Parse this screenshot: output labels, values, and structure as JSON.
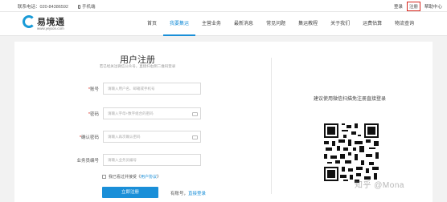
{
  "topbar": {
    "contact_label": "联系电话：",
    "contact_phone": "020-84386592",
    "mobile_label": "手机端",
    "login": "登录",
    "register": "注册",
    "help": "帮助中心"
  },
  "logo": {
    "name": "易境通",
    "url": "www.yejoon.com"
  },
  "nav": [
    "首页",
    "我要集运",
    "主营业务",
    "最新消息",
    "常见问题",
    "集运教程",
    "关于我们",
    "运费估算",
    "物流查询"
  ],
  "form": {
    "title": "用户注册",
    "subtitle": "若已经关注微信公众号，直接扫右侧二维码登录",
    "fields": [
      {
        "label": "账号",
        "required": true,
        "placeholder": "请输入用户名、邮箱或手机号"
      },
      {
        "label": "密码",
        "required": true,
        "placeholder": "请输入字母+数字组合的密码"
      },
      {
        "label": "确认密码",
        "required": true,
        "placeholder": "请输入再次确认密码"
      },
      {
        "label": "业务员编号",
        "required": false,
        "placeholder": "请输入业务员编号"
      }
    ],
    "agree_text": "我已看过并接受《",
    "agree_link": "用户协议",
    "agree_end": "》",
    "register_button": "立即注册",
    "login_prefix": "有账号，",
    "login_link": "直接登录"
  },
  "qr_section": {
    "text": "建议使用微信扫描免注册直接登录"
  },
  "watermark": "知乎 @Mona",
  "colors": {
    "accent": "#1a8fd8",
    "highlight": "#d8261e"
  }
}
